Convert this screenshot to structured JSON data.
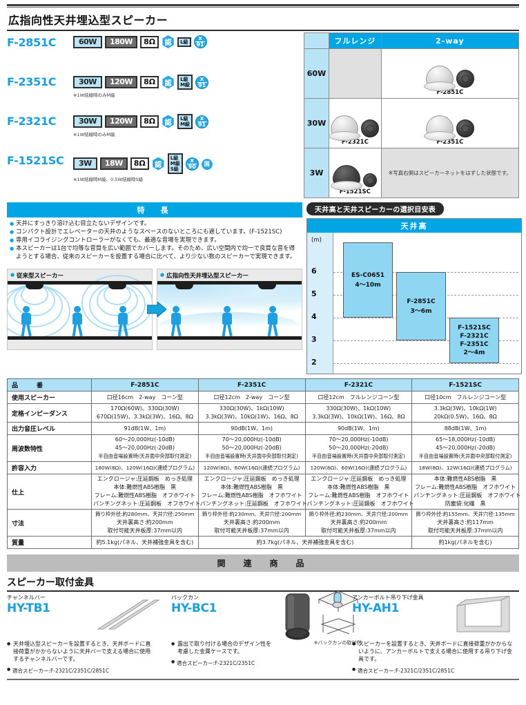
{
  "page": {
    "title": "広指向性天井埋込型スピーカー"
  },
  "models": [
    {
      "name": "F-2851C",
      "rated_w": "60W",
      "max_w": "180W",
      "impedance": "8Ω",
      "cert_icon": "認",
      "ranks": [
        "L級"
      ],
      "x_circle": {
        "top": "X",
        "bottom": "91"
      },
      "kokusan": null,
      "note": ""
    },
    {
      "name": "F-2351C",
      "rated_w": "30W",
      "max_w": "120W",
      "impedance": "8Ω",
      "cert_icon": "認",
      "ranks": [
        "L級",
        "M級"
      ],
      "x_circle": {
        "top": "X",
        "bottom": "91"
      },
      "kokusan": null,
      "note": "※1W結線時のみM級"
    },
    {
      "name": "F-2321C",
      "rated_w": "30W",
      "max_w": "120W",
      "impedance": "8Ω",
      "cert_icon": "認",
      "ranks": [
        "L級",
        "M級"
      ],
      "x_circle": {
        "top": "X",
        "bottom": "91"
      },
      "kokusan": null,
      "note": "※1W結線時のみM級"
    },
    {
      "name": "F-1521SC",
      "rated_w": "3W",
      "max_w": "18W",
      "impedance": "8Ω",
      "cert_icon": "認",
      "ranks": [
        "L級",
        "M級",
        "S級"
      ],
      "x_circle": {
        "top": "X",
        "bottom": "90"
      },
      "kokusan": "国",
      "note": "※1W結線時M級、0.5W結線時S級"
    }
  ],
  "matrix": {
    "columns": [
      "フルレンジ",
      "2-way"
    ],
    "rows": [
      {
        "label": "60W",
        "fullrange": "",
        "twoway": "F-2851C"
      },
      {
        "label": "30W",
        "fullrange": "F-2321C",
        "twoway": "F-2351C"
      },
      {
        "label": "3W",
        "fullrange": "F-1521SC",
        "twoway": ""
      }
    ],
    "note": "※写真右側はスピーカーネットをはずした状態です。"
  },
  "features": {
    "heading": "特　長",
    "items": [
      "天井にすっきり溶け込む目立たないデザインです。",
      "コンパクト設計でエレベーターの天井のようなスペースのないところにも適しています。(F-1521SC)",
      "専用イコライジングコントローラーがなくても、最適な音場を実現できます。",
      "本スピーカーは1台で均等な音質を広い範囲でカバーします。そのため、広い空間内で均一で良質な音を得ようとする場合、従来のスピーカーを設置する場合に比べて、より少ない数のスピーカーで実現できます。"
    ]
  },
  "comparison": {
    "left_label": "従来型スピーカー",
    "right_label": "広指向性天井埋込型スピーカー"
  },
  "chart_data": {
    "type": "bar",
    "title": "天井高と天井スピーカーの選択目安表",
    "header": "天井高",
    "ylabel": "(m)",
    "ylim": [
      1.3,
      7.0
    ],
    "yticks": [
      2,
      3,
      4,
      5,
      6
    ],
    "grid": true,
    "categories": [
      "ES-C0651",
      "F-2851C",
      "F-1521SC / F-2321C / F-2351C"
    ],
    "bars": [
      {
        "labels": [
          "ES-C0651",
          "4〜10m"
        ],
        "ymin": 4,
        "ymax": 7.0,
        "range_text": "4〜10m"
      },
      {
        "labels": [
          "F-2851C",
          "3〜6m"
        ],
        "ymin": 3,
        "ymax": 6,
        "range_text": "3〜6m"
      },
      {
        "labels": [
          "F-1521SC",
          "F-2321C",
          "F-2351C",
          "2〜4m"
        ],
        "ymin": 2,
        "ymax": 4,
        "range_text": "2〜4m"
      }
    ]
  },
  "spec": {
    "header_label": "品　　　番",
    "columns": [
      "F-2851C",
      "F-2351C",
      "F-2321C",
      "F-1521SC"
    ],
    "rows": [
      {
        "label": "使用スピーカー",
        "values": [
          [
            "口径16cm　2-way　コーン型"
          ],
          [
            "口径12cm　2-way　コーン型"
          ],
          [
            "口径12cm　フルレンジコーン型"
          ],
          [
            "口径10cm　フルレンジコーン型"
          ]
        ]
      },
      {
        "label": "定格インピーダンス",
        "values": [
          [
            "170Ω(60W)、330Ω(30W)",
            "670Ω(15W)、3.3kΩ(3W)、16Ω、8Ω"
          ],
          [
            "330Ω(30W)、1kΩ(10W)",
            "3.3kΩ(3W)、10kΩ(1W)、16Ω、8Ω"
          ],
          [
            "330Ω(30W)、1kΩ(10W)",
            "3.3kΩ(3W)、10kΩ(1W)、16Ω、8Ω"
          ],
          [
            "3.3kΩ(3W)、10kΩ(1W)",
            "20kΩ(0.5W)、16Ω、8Ω"
          ]
        ]
      },
      {
        "label": "出力音圧レベル",
        "values": [
          [
            "91dB(1W、1m)"
          ],
          [
            "90dB(1W、1m)"
          ],
          [
            "90dB(1W、1m)"
          ],
          [
            "88dB(1W、1m)"
          ]
        ]
      },
      {
        "label": "周波数特性",
        "values": [
          [
            "60〜20,000Hz(-10dB)",
            "45〜20,000Hz(-20dB)",
            "半自由音場設置時(天井面中央部取付測定)"
          ],
          [
            "70〜20,000Hz(-10dB)",
            "50〜20,000Hz(-20dB)",
            "半自由音場設置時(天井面中央部取付測定)"
          ],
          [
            "70〜20,000Hz(-10dB)",
            "50〜20,000Hz(-20dB)",
            "半自由音場設置時(天井面中央部取付測定)"
          ],
          [
            "65〜18,000Hz(-10dB)",
            "45〜20,000Hz(-20dB)",
            "半自由音場設置時(天井面中央部取付測定)"
          ]
        ]
      },
      {
        "label": "許容入力",
        "values": [
          [
            "180W(8Ω)、120W(16Ω)(連続プログラム)"
          ],
          [
            "120W(8Ω)、60W(16Ω)(連続プログラム)"
          ],
          [
            "120W(8Ω)、60W(16Ω)(連続プログラム)"
          ],
          [
            "18W(8Ω)、12W(16Ω)(連続プログラム)"
          ]
        ]
      },
      {
        "label": "仕上",
        "values": [
          [
            "エンクロージャ:圧延鋼板　めっき処理",
            "本体:難燃性ABS樹脂　黒",
            "フレーム:難燃性ABS樹脂　オフホワイト",
            "パンチングネット:圧延鋼板　オフホワイト"
          ],
          [
            "エンクロージャ:圧延鋼板　めっき処理",
            "本体:難燃性ABS樹脂　黒",
            "フレーム:難燃性ABS樹脂　オフホワイト",
            "パンチングネット:圧延鋼板　オフホワイト"
          ],
          [
            "エンクロージャ:圧延鋼板　めっき処理",
            "本体:難燃性ABS樹脂　黒",
            "フレーム:難燃性ABS樹脂　オフホワイト",
            "パンチングネット:圧延鋼板　オフホワイト"
          ],
          [
            "本体:難燃性ABS樹脂　黒",
            "フレーム:難燃性ABS樹脂　オフホワイト",
            "パンチングネット:圧延鋼板　オフホワイト",
            "防塵袋:化繊　黒"
          ]
        ]
      },
      {
        "label": "寸法",
        "values": [
          [
            "飾り枠外径:約280mm、天井穴径:250mm",
            "天井裏高さ:約200mm",
            "取付可能天井板厚:37mm以内"
          ],
          [
            "飾り枠外径:約230mm、天井穴径:200mm",
            "天井裏高さ:約200mm",
            "取付可能天井板厚:37mm以内"
          ],
          [
            "飾り枠外径:約230mm、天井穴径:200mm",
            "天井裏高さ:約200mm",
            "取付可能天井板厚:37mm以内"
          ],
          [
            "飾り枠外径:約155mm、天井穴径:135mm",
            "天井裏高さ:約117mm",
            "取付可能天井板厚:37mm以内"
          ]
        ]
      },
      {
        "label": "質量",
        "values": [
          [
            "約5.1kg(パネル、天井補強金具を含む)"
          ],
          [
            "約3.7kg(パネル、天井補強金具を含む)"
          ],
          [
            "約3.7kg(パネル、天井補強金具を含む)"
          ],
          [
            "約1kg(パネルを含む)"
          ]
        ]
      }
    ]
  },
  "related": {
    "bar_title": "関　連　商　品",
    "section_title": "スピーカー取付金具",
    "items": [
      {
        "category": "チャンネルバー",
        "model": "HY-TB1",
        "description": "天井埋込型スピーカーを設置するとき、天井ボードに直接荷重がかからないように天井バーで支える場合に使用するチャンネルバーです。",
        "fit": "適合スピーカー:F-2321C/2351C/2851C",
        "photo_note": ""
      },
      {
        "category": "バックカン",
        "model": "HY-BC1",
        "description": "露出で取り付ける場合のデザイン性を考慮した金属ケースです。",
        "fit": "適合スピーカー:F-2321C/2351C",
        "photo_note": "※バックカンの取付例"
      },
      {
        "category": "アンカーボルト吊り下げ金具",
        "model": "HY-AH1",
        "description": "スピーカーを設置するとき、天井ボードに直接荷重がかからないように、アンカーボルトで支える場合に使用する吊り下げ金具です。",
        "fit": "適合スピーカー:F-2321C/2351C/2851C",
        "photo_note": ""
      }
    ]
  },
  "colors": {
    "accent_blue": "#1b9ede",
    "header_blue": "#00a5e3",
    "light_blue": "#b9e3f6",
    "bar_gray": "#bcbcbc"
  }
}
